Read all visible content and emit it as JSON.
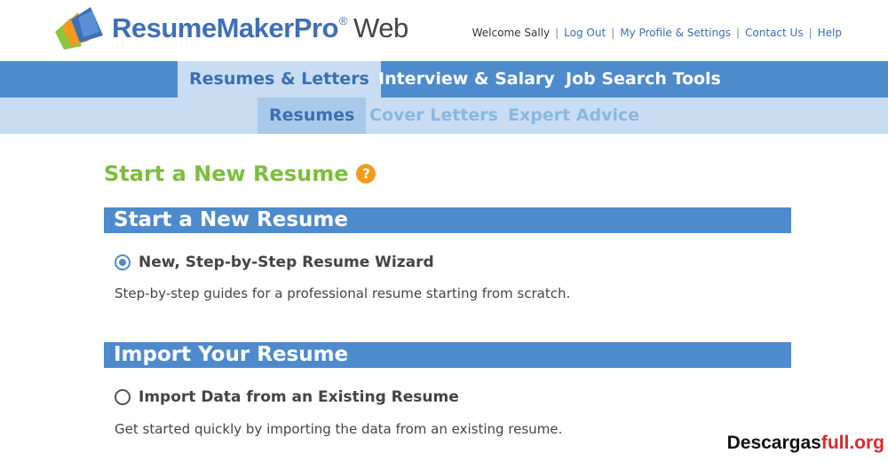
{
  "header": {
    "logo": {
      "brand": "ResumeMaker",
      "brand_suffix": "Pro",
      "reg_mark": "®",
      "product": "Web"
    },
    "top_links": {
      "welcome": "Welcome Sally",
      "logout": "Log Out",
      "profile": "My Profile & Settings",
      "contact": "Contact Us",
      "help": "Help"
    }
  },
  "primary_nav": {
    "items": [
      {
        "label": "Resumes & Letters",
        "active": true
      },
      {
        "label": "Interview & Salary",
        "active": false
      },
      {
        "label": "Job Search Tools",
        "active": false
      }
    ]
  },
  "secondary_nav": {
    "items": [
      {
        "label": "Resumes",
        "active": true
      },
      {
        "label": "Cover Letters",
        "active": false
      },
      {
        "label": "Expert Advice",
        "active": false
      }
    ]
  },
  "main": {
    "title": "Start a New Resume",
    "help_icon": "?",
    "sections": [
      {
        "heading": "Start a New Resume",
        "option_label": "New, Step-by-Step Resume Wizard",
        "selected": true,
        "description": "Step-by-step guides for a professional resume starting from scratch."
      },
      {
        "heading": "Import Your Resume",
        "option_label": "Import Data from an Existing Resume",
        "selected": false,
        "description": "Get started quickly by importing the data from an existing resume."
      }
    ]
  },
  "watermark": {
    "part1": "Descargas",
    "part2": "full.org"
  },
  "colors": {
    "nav_blue": "#4e8bcd",
    "nav_light": "#c8ddf2",
    "title_green": "#7bbf3a",
    "help_orange": "#f39a1d",
    "link_blue": "#3a6fb5"
  }
}
